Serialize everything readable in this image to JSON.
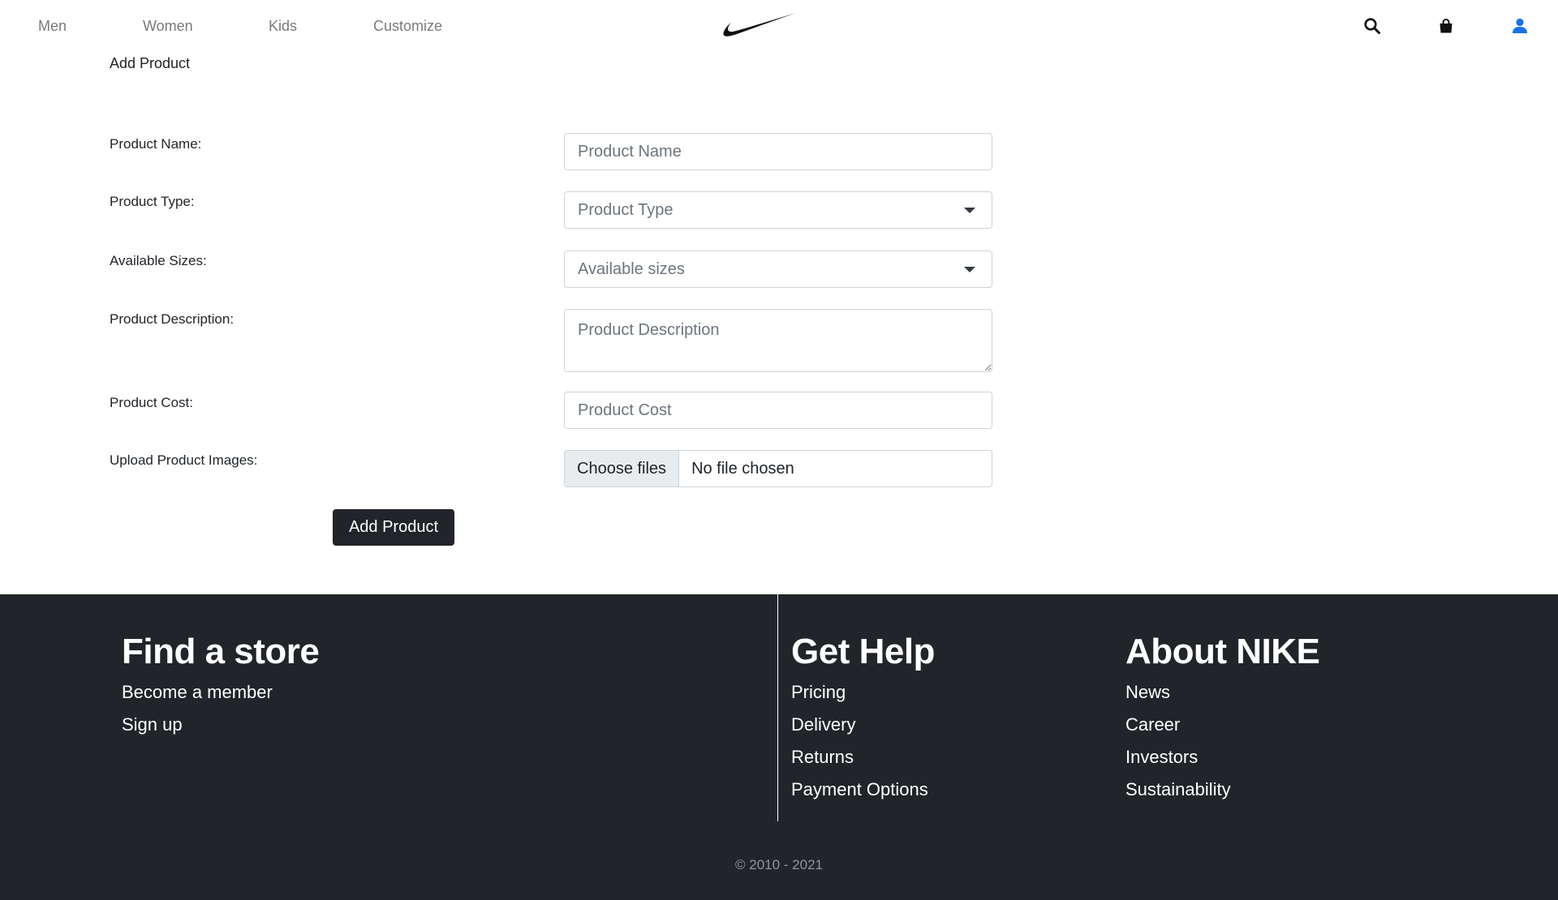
{
  "nav": {
    "links": [
      "Men",
      "Women",
      "Kids",
      "Customize"
    ],
    "icons": [
      "search-icon",
      "bag-icon",
      "user-icon"
    ],
    "accent_color": "#1a73e8"
  },
  "form": {
    "title": "Add Product",
    "fields": {
      "name": {
        "label": "Product Name:",
        "placeholder": "Product Name"
      },
      "type": {
        "label": "Product Type:",
        "placeholder": "Product Type"
      },
      "sizes": {
        "label": "Available Sizes:",
        "placeholder": "Available sizes"
      },
      "description": {
        "label": "Product Description:",
        "placeholder": "Product Description"
      },
      "cost": {
        "label": "Product Cost:",
        "placeholder": "Product Cost"
      },
      "images": {
        "label": "Upload Product Images:",
        "button": "Choose files",
        "status": "No file chosen"
      }
    },
    "submit_label": "Add Product"
  },
  "footer": {
    "store": {
      "heading": "Find a store",
      "links": [
        "Become a member",
        "Sign up"
      ]
    },
    "help": {
      "heading": "Get Help",
      "links": [
        "Pricing",
        "Delivery",
        "Returns",
        "Payment Options"
      ]
    },
    "about": {
      "heading": "About NIKE",
      "links": [
        "News",
        "Career",
        "Investors",
        "Sustainability"
      ]
    },
    "copyright": "© 2010 - 2021"
  }
}
